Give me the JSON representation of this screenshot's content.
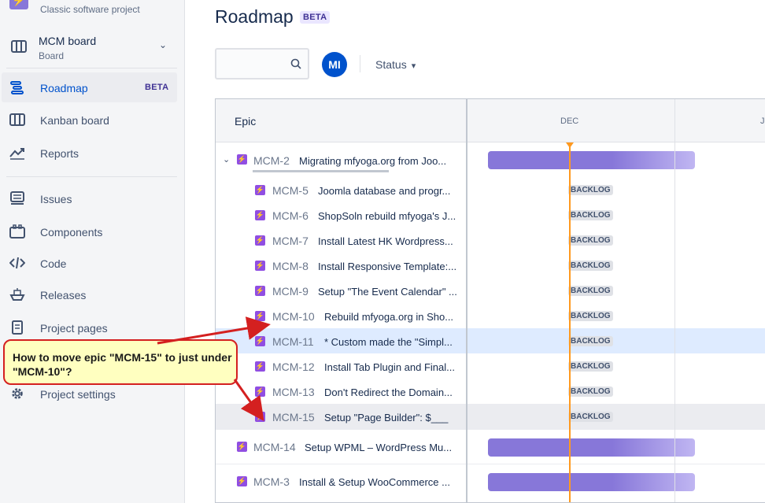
{
  "sidebar": {
    "project_type": "Classic software project",
    "board_name": "MCM board",
    "board_sub": "Board",
    "items": [
      {
        "label": "Roadmap",
        "badge": "BETA"
      },
      {
        "label": "Kanban board"
      },
      {
        "label": "Reports"
      },
      {
        "label": "Issues"
      },
      {
        "label": "Components"
      },
      {
        "label": "Code"
      },
      {
        "label": "Releases"
      },
      {
        "label": "Project pages"
      },
      {
        "label": "Project settings"
      }
    ]
  },
  "header": {
    "title": "Roadmap",
    "badge": "BETA",
    "avatar_initials": "MI",
    "status_filter": "Status"
  },
  "grid": {
    "epic_header": "Epic",
    "months": [
      "DEC",
      "J"
    ],
    "rows": [
      {
        "key": "MCM-2",
        "summary": "Migrating mfyoga.org from Joo...",
        "level": "epic",
        "expanded": true
      },
      {
        "key": "MCM-5",
        "summary": "Joomla database and progr...",
        "status": "BACKLOG"
      },
      {
        "key": "MCM-6",
        "summary": "ShopSoln rebuild mfyoga's J...",
        "status": "BACKLOG"
      },
      {
        "key": "MCM-7",
        "summary": "Install Latest HK Wordpress...",
        "status": "BACKLOG"
      },
      {
        "key": "MCM-8",
        "summary": "Install Responsive Template:...",
        "status": "BACKLOG"
      },
      {
        "key": "MCM-9",
        "summary": "Setup \"The Event Calendar\" ...",
        "status": "BACKLOG"
      },
      {
        "key": "MCM-10",
        "summary": "Rebuild mfyoga.org in Sho...",
        "status": "BACKLOG"
      },
      {
        "key": "MCM-11",
        "summary": "* Custom made the \"Simpl...",
        "status": "BACKLOG",
        "selected": true
      },
      {
        "key": "MCM-12",
        "summary": "Install Tab Plugin and Final...",
        "status": "BACKLOG"
      },
      {
        "key": "MCM-13",
        "summary": "Don't Redirect the Domain...",
        "status": "BACKLOG"
      },
      {
        "key": "MCM-15",
        "summary": "Setup \"Page Builder\": $___",
        "status": "BACKLOG",
        "hover": true
      },
      {
        "key": "MCM-14",
        "summary": "Setup WPML – WordPress Mu...",
        "level": "epic"
      },
      {
        "key": "MCM-3",
        "summary": "Install & Setup WooCommerce ...",
        "level": "epic"
      }
    ]
  },
  "annotation": {
    "text": "How to move epic \"MCM-15\" to just under \"MCM-10\"?"
  },
  "colors": {
    "accent": "#0052cc",
    "epic": "#904ee2",
    "bar": "#8777d9",
    "today": "#ff991f",
    "callout_border": "#d42020"
  }
}
